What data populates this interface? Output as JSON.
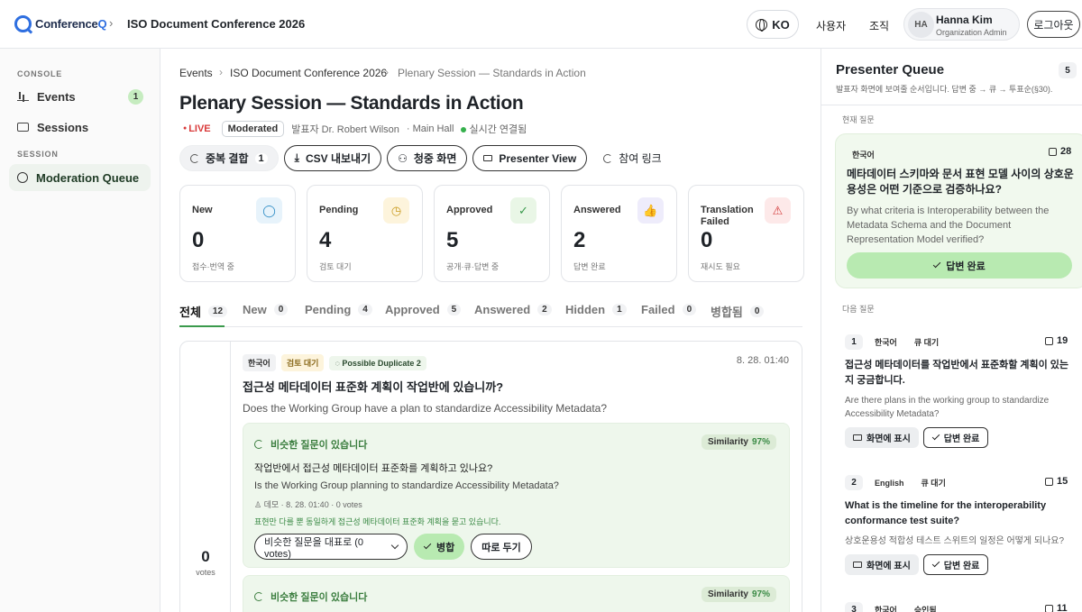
{
  "app": {
    "brand_prefix": "Conference",
    "brand_suffix": "Q",
    "conference_title": "ISO Document Conference 2026"
  },
  "header": {
    "language": "KO",
    "nav_users": "사용자",
    "nav_org": "조직",
    "user_initials": "HA",
    "user_name": "Hanna Kim",
    "user_role": "Organization Admin",
    "logout": "로그아웃"
  },
  "sidebar": {
    "console_label": "CONSOLE",
    "events_label": "Events",
    "events_badge": "1",
    "sessions_label": "Sessions",
    "session_label": "SESSION",
    "moderation_label": "Moderation Queue"
  },
  "breadcrumb": {
    "b1": "Events",
    "b2": "ISO Document Conference 2026",
    "b3": "Plenary Session — Standards in Action"
  },
  "session": {
    "title": "Plenary Session — Standards in Action",
    "live": "LIVE",
    "mode": "Moderated",
    "presenter": "발표자 Dr. Robert Wilson",
    "hall": "· Main Hall",
    "connection": "실시간 연결됨"
  },
  "actions": {
    "merge_label": "중복 결합",
    "merge_count": "1",
    "csv": "CSV 내보내기",
    "audience": "청중 화면",
    "presenter": "Presenter View",
    "join_link": "참여 링크"
  },
  "stats": [
    {
      "label": "New",
      "value": "0",
      "sub": "접수·번역 중",
      "icon": "chat-icon",
      "bg": "#e7f3fb",
      "fg": "#2a8ac4"
    },
    {
      "label": "Pending",
      "value": "4",
      "sub": "검토 대기",
      "icon": "clock-icon",
      "bg": "#fdf4dc",
      "fg": "#c99a1e"
    },
    {
      "label": "Approved",
      "value": "5",
      "sub": "공개·큐·답변 중",
      "icon": "check-icon",
      "bg": "#e9f6e6",
      "fg": "#3a9a4c"
    },
    {
      "label": "Answered",
      "value": "2",
      "sub": "답변 완료",
      "icon": "thumbs-up-icon",
      "bg": "#eeecfb",
      "fg": "#5a52c4"
    },
    {
      "label": "Translation Failed",
      "value": "0",
      "sub": "재시도 필요",
      "icon": "warning-icon",
      "bg": "#fde9e9",
      "fg": "#d33a3a"
    }
  ],
  "tabs": [
    {
      "label": "전체",
      "count": "12"
    },
    {
      "label": "New",
      "count": "0"
    },
    {
      "label": "Pending",
      "count": "4"
    },
    {
      "label": "Approved",
      "count": "5"
    },
    {
      "label": "Answered",
      "count": "2"
    },
    {
      "label": "Hidden",
      "count": "1"
    },
    {
      "label": "Failed",
      "count": "0"
    },
    {
      "label": "병합됨",
      "count": "0"
    }
  ],
  "question": {
    "lang": "한국어",
    "status": "검토 대기",
    "dup_label": "Possible Duplicate",
    "dup_count": "2",
    "time": "8. 28. 01:40",
    "text_ko": "접근성 메타데이터 표준화 계획이 작업반에 있습니까?",
    "text_en": "Does the Working Group have a plan to standardize Accessibility Metadata?",
    "votes": "0",
    "votes_label": "votes",
    "similar": {
      "heading": "비슷한 질문이 있습니다",
      "score_label": "Similarity",
      "score": "97%",
      "ko": "작업반에서 접근성 메타데이터 표준화를 계획하고 있나요?",
      "en": "Is the Working Group planning to standardize Accessibility Metadata?",
      "author": "데모",
      "time": "8. 28. 01:40",
      "votes": "0 votes",
      "note": "표현만 다를 뿐 동일하게 접근성 메타데이터 표준화 계획을 묻고 있습니다.",
      "select": "비슷한 질문을 대표로 (0 votes)",
      "merge": "병합",
      "keep": "따로 두기"
    },
    "similar2": {
      "heading": "비슷한 질문이 있습니다",
      "score_label": "Similarity",
      "score": "97%"
    }
  },
  "presenter_queue": {
    "title": "Presenter Queue",
    "count": "5",
    "subtitle": "발표자 화면에 보여줄 순서입니다. 답변 중 → 큐 → 투표순(§30).",
    "current_label": "현재 질문",
    "current": {
      "lang": "한국어",
      "likes": "28",
      "ko": "메타데이터 스키마와 문서 표현 모델 사이의 상호운용성은 어떤 기준으로 검증하나요?",
      "en": "By what criteria is Interoperability between the Metadata Schema and the Document Representation Model verified?",
      "done": "답변 완료"
    },
    "next_label": "다음 질문",
    "next": [
      {
        "num": "1",
        "lang": "한국어",
        "status": "큐 대기",
        "likes": "19",
        "title": "접근성 메타데이터를 작업반에서 표준화할 계획이 있는지 궁금합니다.",
        "sub": "Are there plans in the working group to standardize Accessibility Metadata?",
        "show": "화면에 표시",
        "done": "답변 완료"
      },
      {
        "num": "2",
        "lang": "English",
        "status": "큐 대기",
        "likes": "15",
        "title": "What is the timeline for the interoperability conformance test suite?",
        "sub": "상호운용성 적합성 테스트 스위트의 일정은 어떻게 되나요?",
        "show": "화면에 표시",
        "done": "답변 완료"
      },
      {
        "num": "3",
        "lang": "한국어",
        "status": "승인됨",
        "likes": "11"
      }
    ]
  }
}
